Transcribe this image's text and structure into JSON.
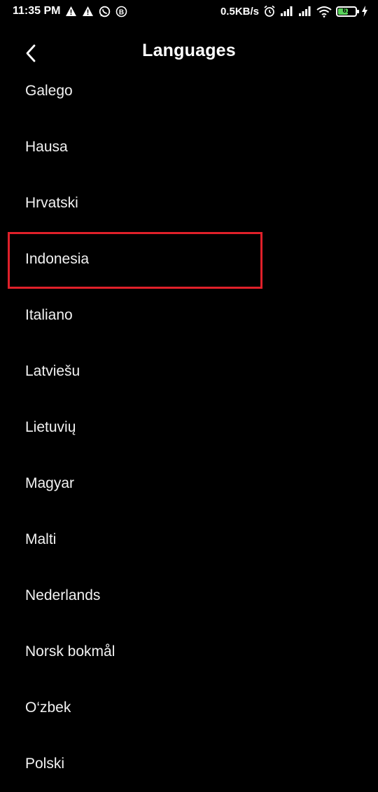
{
  "status_bar": {
    "time": "11:35 PM",
    "network_speed": "0.5KB/s",
    "battery_level": "61",
    "battery_fraction": 0.61,
    "left_icons": [
      "warning-icon",
      "warning-icon",
      "whatsapp-icon",
      "b-badge-icon"
    ],
    "right_icons": [
      "alarm-icon",
      "signal-icon",
      "signal-icon",
      "wifi-icon",
      "battery-icon",
      "charging-icon"
    ],
    "battery_color": "#58d25a"
  },
  "header": {
    "title": "Languages",
    "back_icon": "chevron-left-icon"
  },
  "languages": [
    "Galego",
    "Hausa",
    "Hrvatski",
    "Indonesia",
    "Italiano",
    "Latviešu",
    "Lietuvių",
    "Magyar",
    "Malti",
    "Nederlands",
    "Norsk bokmål",
    "O‘zbek",
    "Polski"
  ],
  "highlighted_language": "Indonesia",
  "highlight_color": "#e0202a"
}
